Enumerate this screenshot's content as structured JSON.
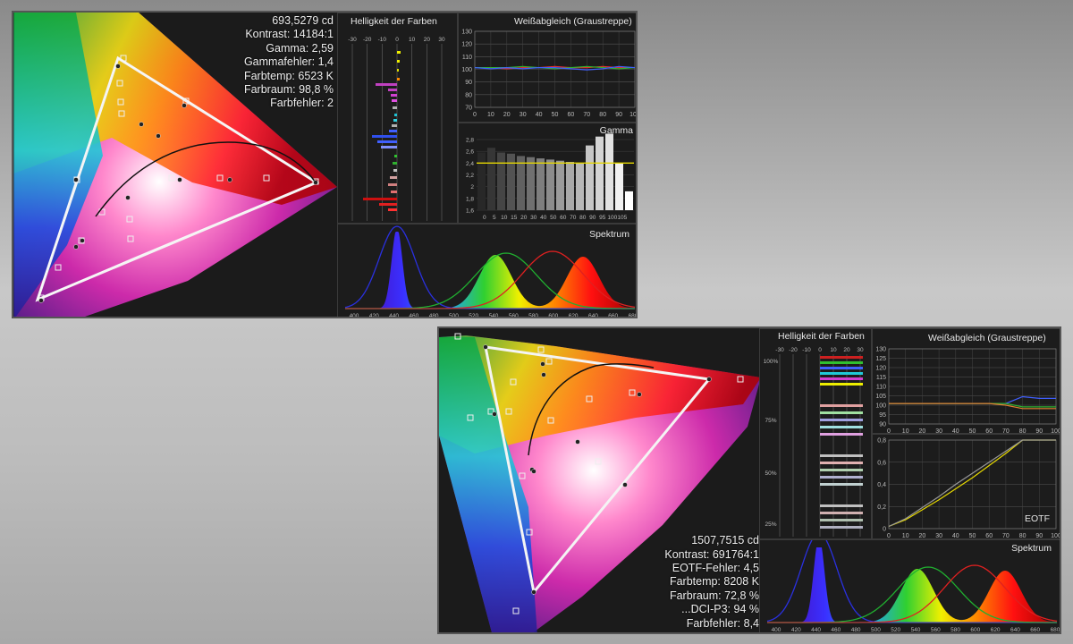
{
  "panel1": {
    "stats": [
      "693,5279 cd",
      "Kontrast: 14184:1",
      "Gamma: 2,59",
      "Gammafehler: 1,4",
      "Farbtemp: 6523 K",
      "Farbraum: 98,8 %",
      "Farbfehler: 2"
    ],
    "brightness_title": "Helligkeit der Farben",
    "brightness_ticks": [
      "-30",
      "-20",
      "-10",
      "0",
      "10",
      "20",
      "30"
    ],
    "wb_title": "Weißabgleich (Graustreppe)",
    "wb_yticks": [
      "130",
      "120",
      "110",
      "100",
      "90",
      "80",
      "70"
    ],
    "wb_xticks": [
      "0",
      "10",
      "20",
      "30",
      "40",
      "50",
      "60",
      "70",
      "80",
      "90",
      "100"
    ],
    "gamma_title": "Gamma",
    "gamma_yticks": [
      "2,8",
      "2,6",
      "2,4",
      "2,2",
      "2",
      "1,8",
      "1,6"
    ],
    "gamma_xticks": [
      "0",
      "5",
      "10",
      "15",
      "20",
      "30",
      "40",
      "50",
      "60",
      "70",
      "80",
      "90",
      "95",
      "100",
      "105"
    ],
    "spectrum_title": "Spektrum",
    "spectrum_xticks": [
      "400",
      "420",
      "440",
      "460",
      "480",
      "500",
      "520",
      "540",
      "560",
      "580",
      "600",
      "620",
      "640",
      "660",
      "680"
    ]
  },
  "panel2": {
    "stats": [
      "1507,7515 cd",
      "Kontrast: 691764:1",
      "EOTF-Fehler: 4,5",
      "Farbtemp: 8208 K",
      "Farbraum: 72,8 %",
      "...DCI-P3: 94 %",
      "Farbfehler: 8,4"
    ],
    "brightness_title": "Helligkeit der Farben",
    "brightness_ticks": [
      "-30",
      "-20",
      "-10",
      "0",
      "10",
      "20",
      "30"
    ],
    "brightness_pct": [
      "100%",
      "75%",
      "50%",
      "25%"
    ],
    "wb_title": "Weißabgleich (Graustreppe)",
    "wb_yticks": [
      "130",
      "125",
      "120",
      "115",
      "110",
      "105",
      "100",
      "95",
      "90"
    ],
    "wb_xticks": [
      "0",
      "10",
      "20",
      "30",
      "40",
      "50",
      "60",
      "70",
      "80",
      "90",
      "100"
    ],
    "eotf_title": "EOTF",
    "eotf_yticks": [
      "0,8",
      "0,6",
      "0,4",
      "0,2",
      "0"
    ],
    "eotf_xticks": [
      "0",
      "10",
      "20",
      "30",
      "40",
      "50",
      "60",
      "70",
      "80",
      "90",
      "100"
    ],
    "spectrum_title": "Spektrum",
    "spectrum_xticks": [
      "400",
      "420",
      "440",
      "460",
      "480",
      "500",
      "520",
      "540",
      "560",
      "580",
      "600",
      "620",
      "640",
      "660",
      "680"
    ]
  },
  "chart_data": [
    {
      "type": "scatter",
      "description_axes": "CIE chromaticity diagram",
      "title": "",
      "series": []
    },
    {
      "type": "bar",
      "title": "Gamma",
      "categories": [
        "0",
        "5",
        "10",
        "15",
        "20",
        "30",
        "40",
        "50",
        "60",
        "70",
        "80",
        "90",
        "95",
        "100",
        "105"
      ],
      "values": [
        2.58,
        2.66,
        2.58,
        2.56,
        2.52,
        2.5,
        2.48,
        2.46,
        2.44,
        2.42,
        2.4,
        2.7,
        2.85,
        2.9,
        2.4,
        1.92
      ],
      "reference": 2.4,
      "ylim": [
        1.6,
        2.8
      ]
    },
    {
      "type": "line",
      "title": "Weißabgleich (Graustreppe)",
      "x": [
        0,
        10,
        20,
        30,
        40,
        50,
        60,
        70,
        80,
        90,
        100
      ],
      "series": [
        {
          "color": "#e03030",
          "values": [
            100,
            100,
            99,
            100,
            100,
            101,
            100,
            100,
            101,
            100,
            100
          ]
        },
        {
          "color": "#30b030",
          "values": [
            100,
            100,
            100,
            101,
            100,
            99,
            100,
            101,
            100,
            99,
            100
          ]
        },
        {
          "color": "#4060ff",
          "values": [
            100,
            99,
            100,
            99,
            100,
            100,
            99,
            98,
            99,
            101,
            100
          ]
        }
      ],
      "ylim": [
        65,
        132
      ]
    },
    {
      "type": "line",
      "title": "EOTF",
      "x": [
        0,
        10,
        20,
        30,
        40,
        50,
        60,
        70,
        80,
        90,
        100
      ],
      "series": [
        {
          "color": "#e6d800",
          "values": [
            0.02,
            0.08,
            0.17,
            0.26,
            0.36,
            0.46,
            0.57,
            0.68,
            0.8,
            0.8,
            0.8
          ]
        },
        {
          "color": "#999999",
          "values": [
            0.02,
            0.09,
            0.19,
            0.29,
            0.4,
            0.5,
            0.6,
            0.7,
            0.8,
            0.8,
            0.8
          ]
        }
      ],
      "ylim": [
        0,
        0.8
      ]
    },
    {
      "type": "line",
      "title": "Weißabgleich (Graustreppe)",
      "x": [
        0,
        10,
        20,
        30,
        40,
        50,
        60,
        70,
        80,
        90,
        100
      ],
      "series": [
        {
          "color": "#4060ff",
          "values": [
            100,
            100,
            100,
            100,
            100,
            100,
            100,
            100,
            104,
            103,
            103
          ]
        },
        {
          "color": "#30b030",
          "values": [
            100,
            100,
            100,
            100,
            100,
            100,
            100,
            100,
            98,
            98,
            98
          ]
        },
        {
          "color": "#e08030",
          "values": [
            100,
            100,
            100,
            100,
            100,
            100,
            100,
            99,
            97,
            97,
            97
          ]
        }
      ],
      "ylim": [
        88,
        132
      ]
    }
  ]
}
